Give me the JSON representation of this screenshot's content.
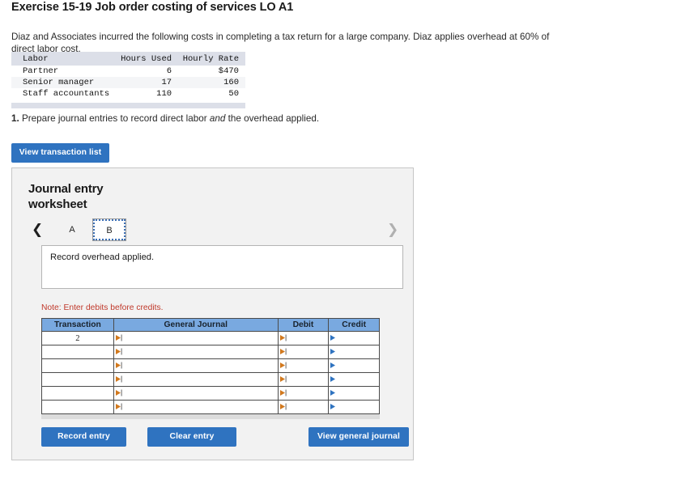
{
  "exercise": {
    "title": "Exercise 15-19 Job order costing of services LO A1",
    "intro": "Diaz and Associates incurred the following costs in completing a tax return for a large company. Diaz applies overhead at 60% of direct labor cost."
  },
  "cost_table": {
    "headers": [
      "Labor",
      "Hours Used",
      "Hourly Rate"
    ],
    "rows": [
      {
        "labor": "Partner",
        "hours": "6",
        "rate": "$470"
      },
      {
        "labor": "Senior manager",
        "hours": "17",
        "rate": "160"
      },
      {
        "labor": "Staff accountants",
        "hours": "110",
        "rate": "50"
      }
    ]
  },
  "requirement": {
    "number": "1.",
    "text_before": " Prepare journal entries to record direct labor ",
    "emphasis": "and",
    "text_after": " the overhead applied."
  },
  "buttons": {
    "view_transaction_list": "View transaction list",
    "record_entry": "Record entry",
    "clear_entry": "Clear entry",
    "view_general_journal": "View general journal"
  },
  "worksheet": {
    "title": "Journal entry worksheet",
    "tabs": [
      {
        "label": "A",
        "active": false
      },
      {
        "label": "B",
        "active": true
      }
    ],
    "prev_icon": "chevron-left",
    "next_icon": "chevron-right",
    "description": "Record overhead applied.",
    "note": "Note: Enter debits before credits."
  },
  "journal_table": {
    "headers": [
      "Transaction",
      "General Journal",
      "Debit",
      "Credit"
    ],
    "rows": [
      {
        "transaction": "2",
        "general_journal": "",
        "debit": "",
        "credit": ""
      },
      {
        "transaction": "",
        "general_journal": "",
        "debit": "",
        "credit": ""
      },
      {
        "transaction": "",
        "general_journal": "",
        "debit": "",
        "credit": ""
      },
      {
        "transaction": "",
        "general_journal": "",
        "debit": "",
        "credit": ""
      },
      {
        "transaction": "",
        "general_journal": "",
        "debit": "",
        "credit": ""
      },
      {
        "transaction": "",
        "general_journal": "",
        "debit": "",
        "credit": ""
      }
    ]
  },
  "colors": {
    "button_blue": "#2f73c0",
    "header_blue": "#79a9e0",
    "note_red": "#c0392b",
    "caret_orange": "#d2791e",
    "caret_blue": "#2f73c0",
    "table_header_gray": "#dcdfe8"
  }
}
